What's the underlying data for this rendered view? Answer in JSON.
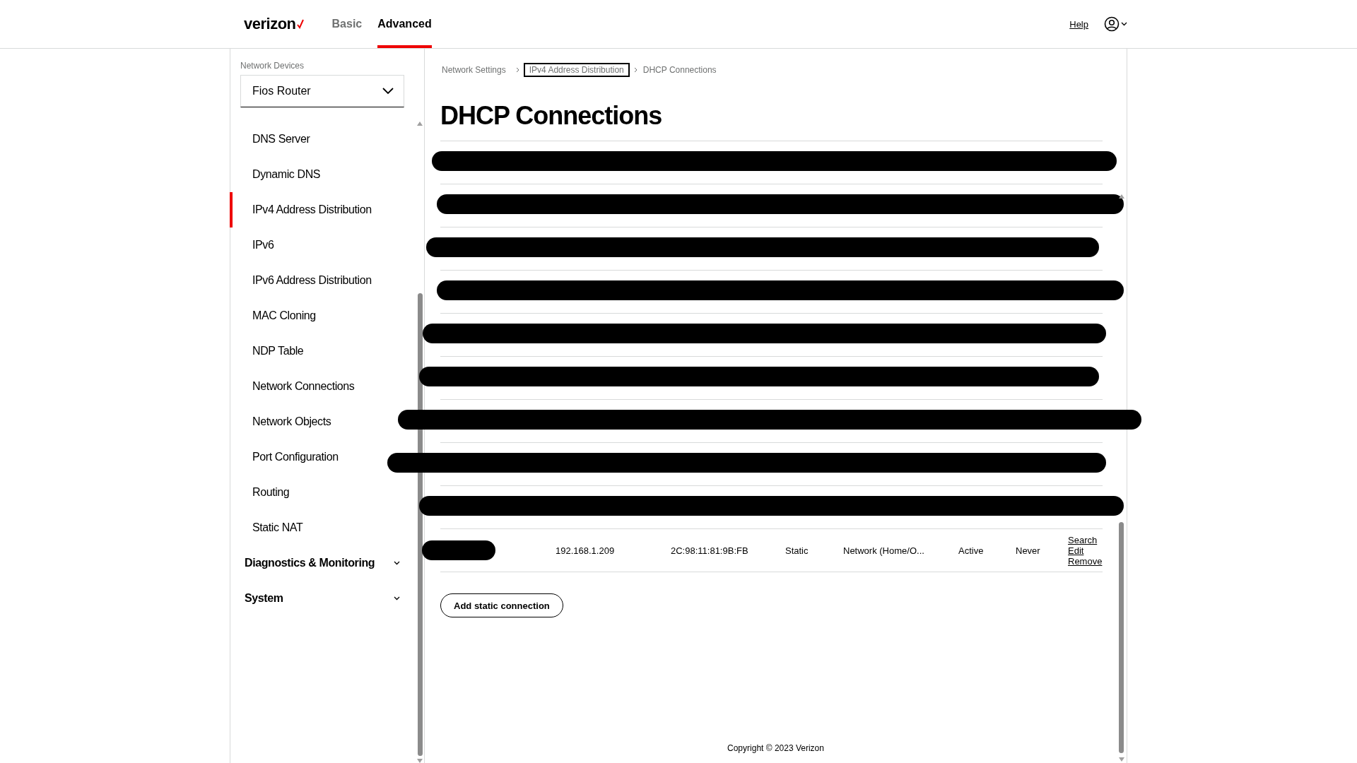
{
  "header": {
    "logo": "verizon",
    "tabs": [
      {
        "label": "Basic",
        "selected": false
      },
      {
        "label": "Advanced",
        "selected": true
      }
    ],
    "help": "Help"
  },
  "sidebar": {
    "device_label": "Network Devices",
    "device": "Fios Router",
    "items": [
      {
        "label": "DNS Server",
        "selected": false
      },
      {
        "label": "Dynamic DNS",
        "selected": false
      },
      {
        "label": "IPv4 Address Distribution",
        "selected": true
      },
      {
        "label": "IPv6",
        "selected": false
      },
      {
        "label": "IPv6 Address Distribution",
        "selected": false
      },
      {
        "label": "MAC Cloning",
        "selected": false
      },
      {
        "label": "NDP Table",
        "selected": false
      },
      {
        "label": "Network Connections",
        "selected": false
      },
      {
        "label": "Network Objects",
        "selected": false
      },
      {
        "label": "Port Configuration",
        "selected": false
      },
      {
        "label": "Routing",
        "selected": false
      },
      {
        "label": "Static NAT",
        "selected": false
      }
    ],
    "sections": [
      {
        "label": "Diagnostics & Monitoring",
        "expanded": false
      },
      {
        "label": "System",
        "expanded": false
      }
    ]
  },
  "breadcrumb": [
    {
      "label": "Network Settings",
      "focused": false
    },
    {
      "label": "IPv4 Address Distribution",
      "focused": true
    },
    {
      "label": "DHCP Connections",
      "focused": false
    }
  ],
  "title": "DHCP Connections",
  "table": {
    "rows": [
      {
        "kind": "redacted"
      },
      {
        "kind": "redacted"
      },
      {
        "kind": "redacted"
      },
      {
        "kind": "redacted"
      },
      {
        "kind": "redacted"
      },
      {
        "kind": "redacted"
      },
      {
        "kind": "redacted"
      },
      {
        "kind": "redacted"
      },
      {
        "kind": "redacted"
      },
      {
        "kind": "entry",
        "ip": "192.168.1.209",
        "mac": "2C:98:11:81:9B:FB",
        "type": "Static",
        "network": "Network (Home/O...",
        "status": "Active",
        "expires": "Never",
        "actions": [
          "Search",
          "Edit",
          "Remove"
        ]
      }
    ]
  },
  "add_button": "Add static connection",
  "footer": "Copyright © 2023 Verizon"
}
